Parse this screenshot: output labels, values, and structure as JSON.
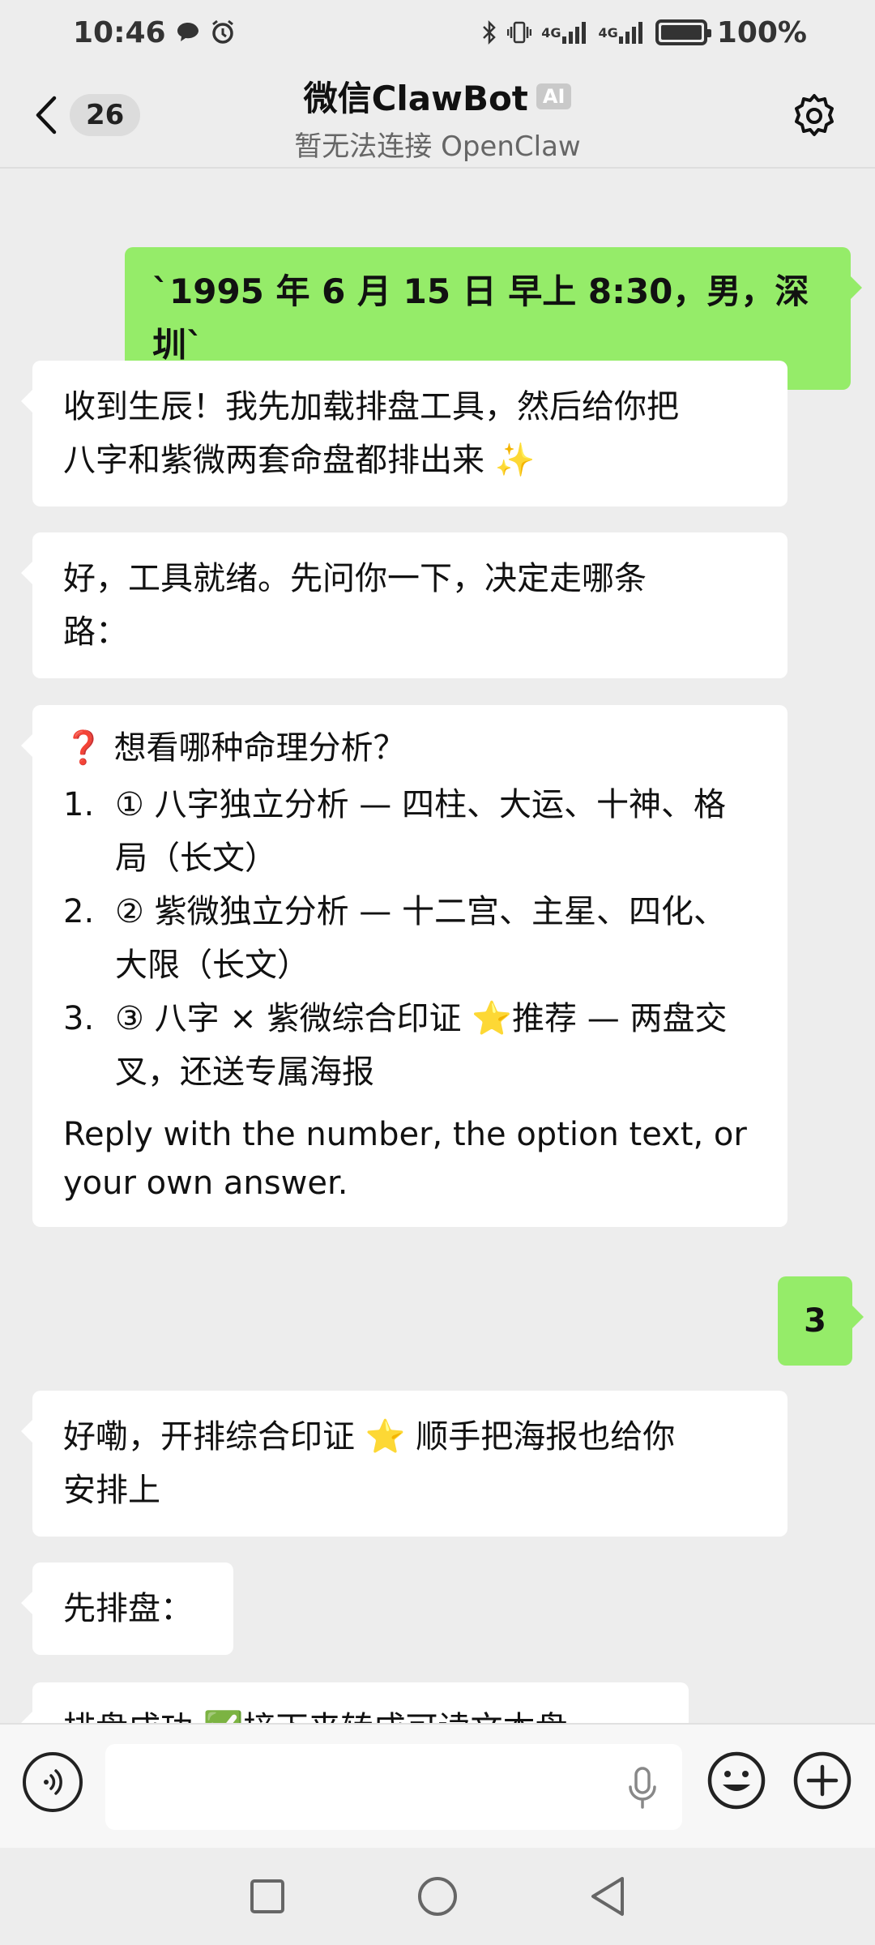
{
  "status_bar": {
    "time": "10:46",
    "net_badge_1": "4G",
    "net_badge_2": "4G",
    "battery": "100%"
  },
  "header": {
    "unread_count": "26",
    "title": "微信ClawBot",
    "ai_badge": "AI",
    "subtitle": "暂无法连接 OpenClaw"
  },
  "messages": [
    {
      "from": "user",
      "text": "`1995 年 6 月 15 日 早上 8:30，男，深圳`"
    },
    {
      "from": "bot",
      "lines": [
        "收到生辰！我先加载排盘工具，然后给你把",
        "八字和紫微两套命盘都排出来 ✨"
      ]
    },
    {
      "from": "bot",
      "lines": [
        "好，工具就绪。先问你一下，决定走哪条",
        "路："
      ]
    },
    {
      "from": "bot",
      "question_mark": "❓",
      "question": "想看哪种命理分析？",
      "options": [
        {
          "num": "1.",
          "text": "① 八字独立分析 — 四柱、大运、十神、格局（长文）"
        },
        {
          "num": "2.",
          "text": "② 紫微独立分析 — 十二宫、主星、四化、大限（长文）"
        },
        {
          "num": "3.",
          "text": "③ 八字 × 紫微综合印证 ⭐推荐 — 两盘交叉，还送专属海报"
        }
      ],
      "note": "Reply with the number, the option text, or your own answer."
    },
    {
      "from": "user",
      "text": "3"
    },
    {
      "from": "bot",
      "lines": [
        "好嘞，开排综合印证 ⭐ 顺手把海报也给你",
        "安排上"
      ]
    },
    {
      "from": "bot",
      "lines": [
        "先排盘："
      ]
    },
    {
      "from": "bot",
      "lines": [
        "排盘成功 ✅接下来转成可读文本盘..."
      ]
    }
  ],
  "input": {
    "placeholder": ""
  },
  "colors": {
    "user_bubble": "#95ec69",
    "bot_bubble": "#ffffff",
    "background": "#ededed"
  },
  "icons": [
    "back-icon",
    "settings-icon",
    "voice-icon",
    "mic-icon",
    "emoji-icon",
    "plus-icon",
    "recents-icon",
    "home-icon",
    "back-nav-icon"
  ]
}
